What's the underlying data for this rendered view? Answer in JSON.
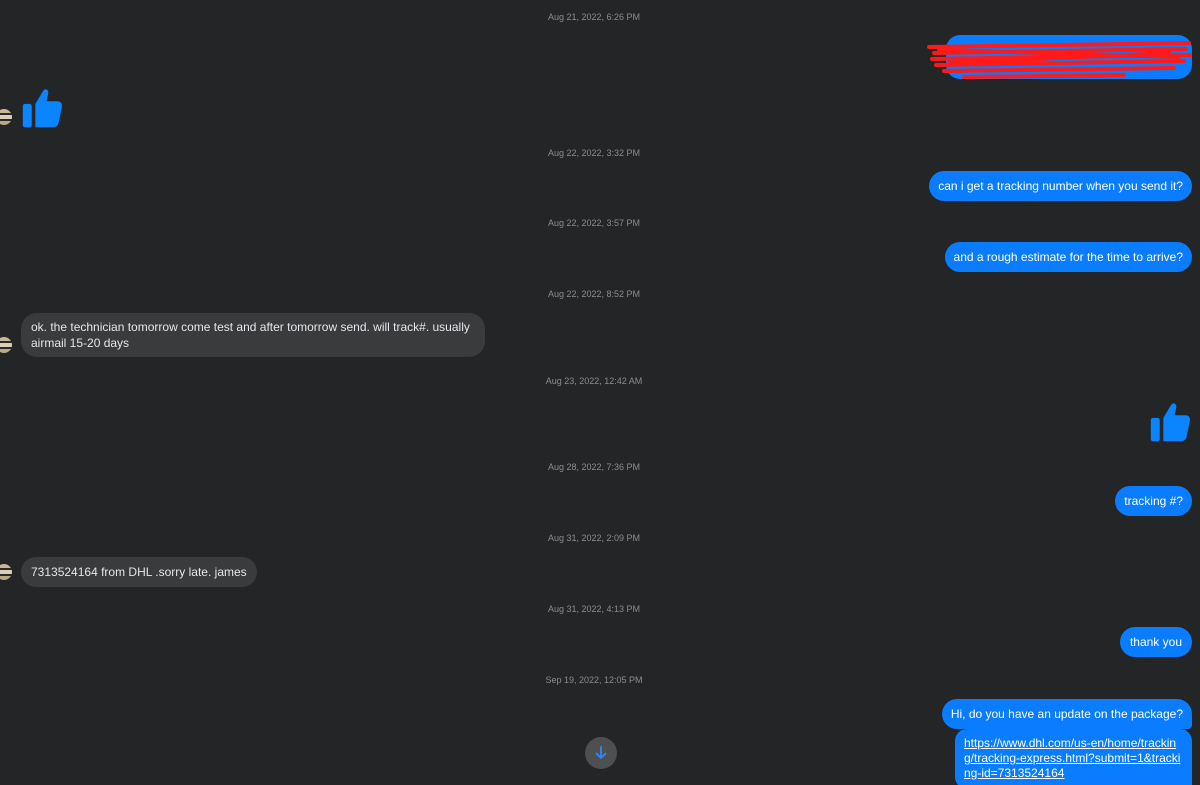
{
  "thread": {
    "timestamps": [
      "Aug 21, 2022, 6:26 PM",
      "Aug 22, 2022, 3:32 PM",
      "Aug 22, 2022, 3:57 PM",
      "Aug 22, 2022, 8:52 PM",
      "Aug 23, 2022, 12:42 AM",
      "Aug 28, 2022, 7:36 PM",
      "Aug 31, 2022, 2:09 PM",
      "Aug 31, 2022, 4:13 PM",
      "Sep 19, 2022, 12:05 PM"
    ],
    "messages": {
      "m_tracking_request": "can i get a tracking number when you send it?",
      "m_estimate_request": "and a rough estimate for the time to arrive?",
      "m_technician_reply_line1": "ok. the technician tomorrow come test and after tomorrow send. will track#. usually",
      "m_technician_reply_line2": "airmail 15-20 days",
      "m_tracking_question": "tracking #?",
      "m_tracking_number_reply": "7313524164  from DHL .sorry late. james",
      "m_thank_you": "thank you",
      "m_update_question": "Hi, do you have an update on the package?",
      "m_dhl_link": "https://www.dhl.com/us-en/home/tracking/tracking-express.html?submit=1&tracking-id=7313524164"
    }
  },
  "icons": {
    "like": "thumbs-up-icon",
    "scroll": "arrow-down-icon",
    "avatar": "contact-avatar"
  },
  "colors": {
    "background": "#242526",
    "outgoing_bubble": "#0a7cff",
    "incoming_bubble": "#3a3b3c",
    "timestamp": "#8a8d91",
    "redaction": "#ff1a1a"
  }
}
